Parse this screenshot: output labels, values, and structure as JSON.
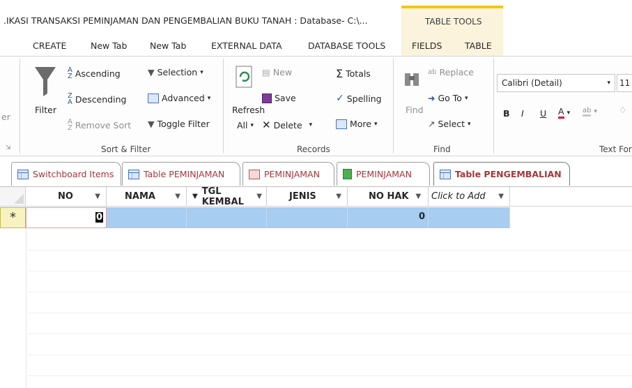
{
  "window": {
    "title": ".IKASI TRANSAKSI PEMINJAMAN DAN PENGEMBALIAN BUKU TANAH : Database- C:\\...",
    "context_tab_group": "TABLE TOOLS"
  },
  "ribbon_tabs": [
    "CREATE",
    "New Tab",
    "New Tab",
    "EXTERNAL DATA",
    "DATABASE TOOLS",
    "FIELDS",
    "TABLE"
  ],
  "ribbon": {
    "view_cut": "er",
    "sort_filter": {
      "filter": "Filter",
      "ascending": "Ascending",
      "descending": "Descending",
      "remove_sort": "Remove Sort",
      "selection": "Selection",
      "advanced": "Advanced",
      "toggle_filter": "Toggle Filter",
      "group_label": "Sort & Filter"
    },
    "records": {
      "refresh": "Refresh",
      "refresh_all": "All",
      "new": "New",
      "save": "Save",
      "delete": "Delete",
      "totals": "Totals",
      "spelling": "Spelling",
      "more": "More",
      "group_label": "Records"
    },
    "find": {
      "find": "Find",
      "replace": "Replace",
      "goto": "Go To",
      "select": "Select",
      "group_label": "Find"
    },
    "text_formatting": {
      "font": "Calibri (Detail)",
      "size": "11",
      "bold": "B",
      "italic": "I",
      "underline": "U",
      "font_color": "A",
      "group_label": "Text For"
    }
  },
  "document_tabs": [
    {
      "label": "Switchboard Items",
      "icon": "table-icon"
    },
    {
      "label": "Table PEMINJAMAN",
      "icon": "table-icon"
    },
    {
      "label": "PEMINJAMAN",
      "icon": "form-icon"
    },
    {
      "label": "PEMINJAMAN",
      "icon": "report-icon"
    },
    {
      "label": "Table PENGEMBALIAN",
      "icon": "table-icon",
      "active": true
    }
  ],
  "datasheet": {
    "columns": [
      "NO",
      "NAMA",
      "TGL KEMBAL",
      "JENIS",
      "NO HAK",
      "Click to Add"
    ],
    "new_row_marker": "*",
    "new_row_values": {
      "no": "0",
      "no_hak": "0"
    }
  },
  "colors": {
    "accent": "#a4373a",
    "selection": "#a7cdf0",
    "table_tools": "#f2c811"
  }
}
